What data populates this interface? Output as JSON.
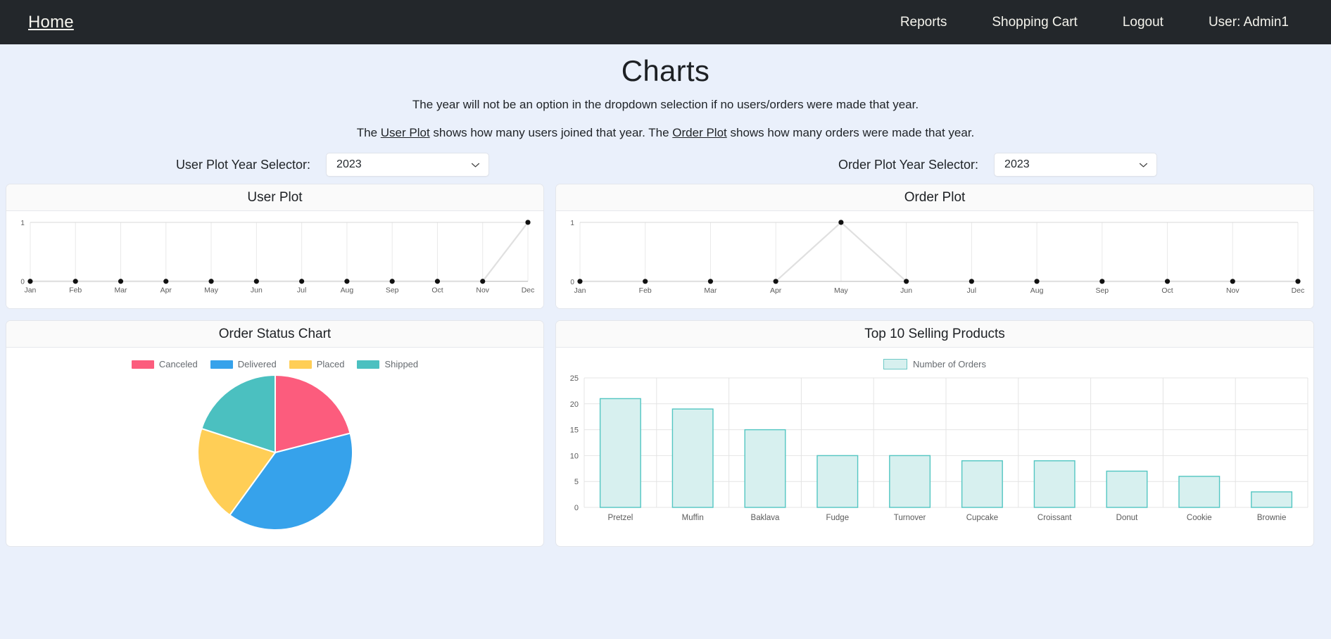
{
  "navbar": {
    "brand": "Home",
    "links": [
      {
        "label": "Reports",
        "name": "nav-link-reports"
      },
      {
        "label": "Shopping Cart",
        "name": "nav-link-shopping-cart"
      },
      {
        "label": "Logout",
        "name": "nav-link-logout"
      },
      {
        "label": "User: Admin1",
        "name": "nav-link-user"
      }
    ]
  },
  "page": {
    "title": "Charts",
    "subtitle": "The year will not be an option in the dropdown selection if no users/orders were made that year.",
    "desc_part1": "The ",
    "desc_link1": "User Plot",
    "desc_part2": " shows how many users joined that year. The ",
    "desc_link2": "Order Plot",
    "desc_part3": " shows how many orders were made that year."
  },
  "selectors": {
    "user_label": "User Plot Year Selector:",
    "user_value": "2023",
    "order_label": "Order Plot Year Selector:",
    "order_value": "2023"
  },
  "cards": {
    "user_plot_title": "User Plot",
    "order_plot_title": "Order Plot",
    "order_status_title": "Order Status Chart",
    "top_products_title": "Top 10 Selling Products"
  },
  "colors": {
    "navbar_bg": "#23272b",
    "page_bg": "#eaf0fb",
    "canceled": "#fc5c7d",
    "delivered": "#36a2eb",
    "placed": "#ffce56",
    "shipped": "#4bc0c0",
    "bar_fill": "#d7f0ef",
    "bar_stroke": "#53c6c2",
    "line_stroke": "#e5e5e5",
    "point": "#181818"
  },
  "chart_data": [
    {
      "id": "user_plot",
      "type": "line",
      "title": "User Plot",
      "categories": [
        "Jan",
        "Feb",
        "Mar",
        "Apr",
        "May",
        "Jun",
        "Jul",
        "Aug",
        "Sep",
        "Oct",
        "Nov",
        "Dec"
      ],
      "values": [
        0,
        0,
        0,
        0,
        0,
        0,
        0,
        0,
        0,
        0,
        0,
        1
      ],
      "xlabel": "",
      "ylabel": "",
      "ylim": [
        0,
        1
      ],
      "yticks": [
        0,
        1
      ],
      "grid": true,
      "legend": false
    },
    {
      "id": "order_plot",
      "type": "line",
      "title": "Order Plot",
      "categories": [
        "Jan",
        "Feb",
        "Mar",
        "Apr",
        "May",
        "Jun",
        "Jul",
        "Aug",
        "Sep",
        "Oct",
        "Nov",
        "Dec"
      ],
      "values": [
        0,
        0,
        0,
        0,
        1,
        0,
        0,
        0,
        0,
        0,
        0,
        0
      ],
      "xlabel": "",
      "ylabel": "",
      "ylim": [
        0,
        1
      ],
      "yticks": [
        0,
        1
      ],
      "grid": true,
      "legend": false
    },
    {
      "id": "order_status_chart",
      "type": "pie",
      "title": "Order Status Chart",
      "labels": [
        "Canceled",
        "Delivered",
        "Placed",
        "Shipped"
      ],
      "values": [
        21,
        39,
        20,
        20
      ],
      "colors": [
        "#fc5c7d",
        "#36a2eb",
        "#ffce56",
        "#4bc0c0"
      ],
      "legend": true,
      "legend_position": "top"
    },
    {
      "id": "top_10_selling_products",
      "type": "bar",
      "title": "Top 10 Selling Products",
      "categories": [
        "Pretzel",
        "Muffin",
        "Baklava",
        "Fudge",
        "Turnover",
        "Cupcake",
        "Croissant",
        "Donut",
        "Cookie",
        "Brownie"
      ],
      "series": [
        {
          "name": "Number of Orders",
          "values": [
            21,
            19,
            15,
            10,
            10,
            9,
            9,
            7,
            6,
            3
          ]
        }
      ],
      "values": [
        21,
        19,
        15,
        10,
        10,
        9,
        9,
        7,
        6,
        3
      ],
      "xlabel": "",
      "ylabel": "",
      "ylim": [
        0,
        25
      ],
      "yticks": [
        0,
        5,
        10,
        15,
        20,
        25
      ],
      "grid": true,
      "legend": true,
      "legend_position": "top"
    }
  ]
}
